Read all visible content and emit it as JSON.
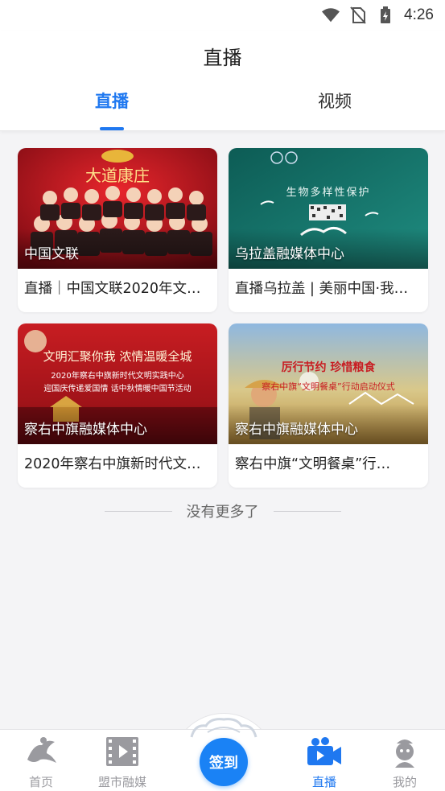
{
  "status_bar": {
    "time": "4:26",
    "icons": [
      "wifi-icon",
      "no-sim-icon",
      "battery-charging-icon"
    ]
  },
  "header": {
    "title": "直播",
    "tabs": [
      {
        "label": "直播",
        "active": true
      },
      {
        "label": "视频",
        "active": false
      }
    ]
  },
  "cards": [
    {
      "source": "中国文联",
      "title": "直播｜中国文联2020年文…",
      "poster_text": "大道康庄"
    },
    {
      "source": "乌拉盖融媒体中心",
      "title": "直播乌拉盖 | 美丽中国·我…",
      "poster_text": "生物多样性保护"
    },
    {
      "source": "察右中旗融媒体中心",
      "title": "2020年察右中旗新时代文…",
      "poster_text": "文明汇聚你我  浓情温暖全城"
    },
    {
      "source": "察右中旗融媒体中心",
      "title": "察右中旗“文明餐桌”行…",
      "poster_text": "厉行节约  珍惜粮食"
    }
  ],
  "poster_lines": {
    "card3": [
      "2020年察右中旗新时代文明实践中心",
      "迎国庆传递爱国情  话中秋情暖中国节活动"
    ],
    "card4": [
      "察右中旗“文明餐桌”行动启动仪式"
    ]
  },
  "footer_text": "没有更多了",
  "bottom_nav": {
    "items": [
      {
        "label": "首页",
        "icon": "home-dancer-icon",
        "active": false
      },
      {
        "label": "盟市融媒",
        "icon": "film-play-icon",
        "active": false
      },
      {
        "label": "直播",
        "icon": "video-camera-icon",
        "active": true
      },
      {
        "label": "我的",
        "icon": "profile-mascot-icon",
        "active": false
      }
    ],
    "checkin_label": "签到"
  },
  "colors": {
    "accent": "#1f78f0",
    "checkin": "#1a82f5",
    "inactive": "#9a9a9f"
  }
}
